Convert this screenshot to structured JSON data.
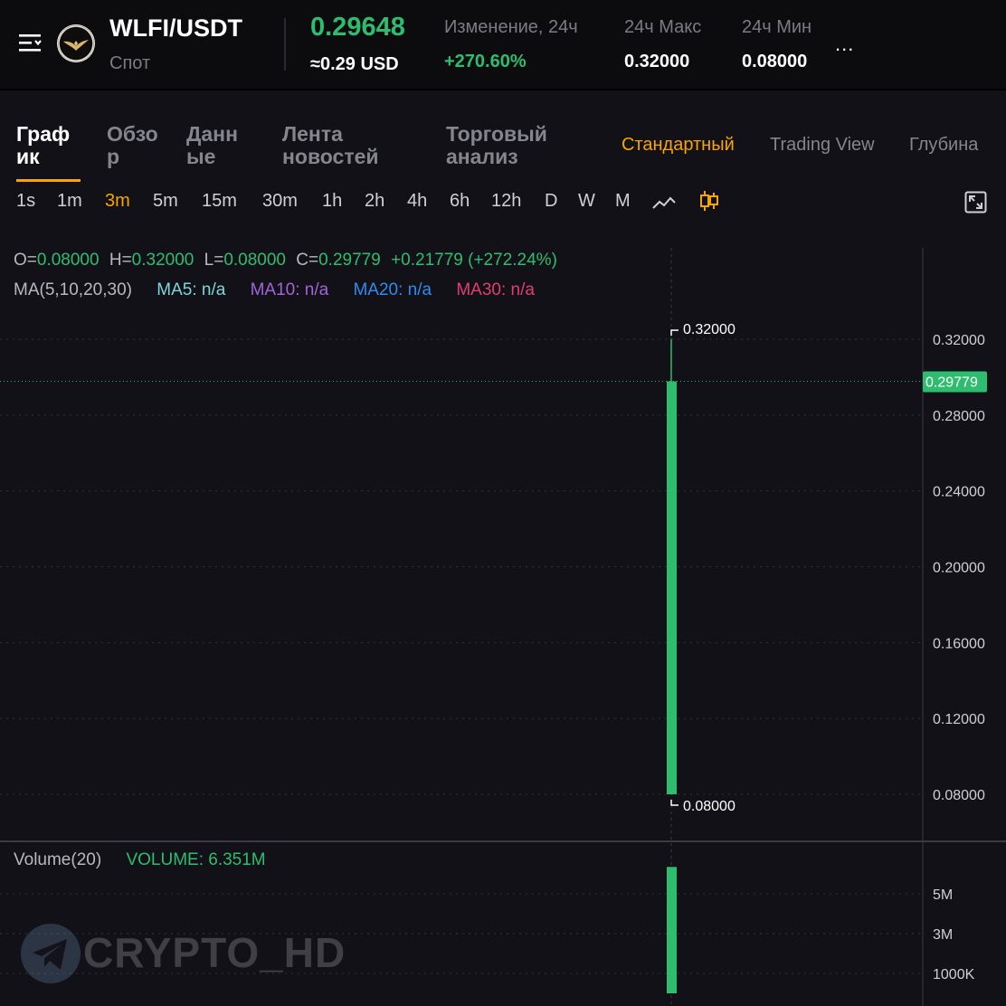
{
  "header": {
    "pair": "WLFI/USDT",
    "market": "Спот",
    "price": "0.29648",
    "price_usd": "≈0.29 USD",
    "change_label": "Изменение, 24ч",
    "change_value": "+270.60%",
    "high_label": "24ч Макс",
    "high_value": "0.32000",
    "low_label": "24ч Мин",
    "low_value": "0.08000",
    "more": "..."
  },
  "tabs": {
    "chart": [
      "Граф",
      "ик"
    ],
    "overview": [
      "Обзо",
      "р"
    ],
    "data": [
      "Данн",
      "ые"
    ],
    "news": [
      "Лента",
      "новостей"
    ],
    "analysis": [
      "Торговый",
      "анализ"
    ]
  },
  "views": {
    "standard": "Стандартный",
    "tradingview": "Trading View",
    "depth": "Глубина"
  },
  "intervals": [
    "1s",
    "1m",
    "3m",
    "5m",
    "15m",
    "30m",
    "1h",
    "2h",
    "4h",
    "6h",
    "12h",
    "D",
    "W",
    "M"
  ],
  "active_interval": "3m",
  "ohlc": {
    "o_label": "O=",
    "o": "0.08000",
    "h_label": "H=",
    "h": "0.32000",
    "l_label": "L=",
    "l": "0.08000",
    "c_label": "C=",
    "c": "0.29779",
    "change": "+0.21779 (+272.24%)"
  },
  "ma": {
    "label": "MA(5,10,20,30)",
    "ma5": "MA5: n/a",
    "ma10": "MA10: n/a",
    "ma20": "MA20: n/a",
    "ma30": "MA30: n/a"
  },
  "volume": {
    "label": "Volume(20)",
    "value": "VOLUME: 6.351M"
  },
  "watermark": "CRYPTO_HD",
  "colors": {
    "up": "#2ebd6e",
    "accent": "#f7a600",
    "ma5": "#7ed6d8",
    "ma10": "#a364d8",
    "ma20": "#2f8bf0",
    "ma30": "#e23d71",
    "background": "#121118"
  },
  "chart_data": {
    "type": "candlestick",
    "price_ticks": [
      "0.32000",
      "0.28000",
      "0.24000",
      "0.20000",
      "0.16000",
      "0.12000",
      "0.08000"
    ],
    "price_range": [
      0.08,
      0.32
    ],
    "candles": [
      {
        "open": 0.08,
        "high": 0.32,
        "low": 0.08,
        "close": 0.29779
      }
    ],
    "last_price_label": "0.29779",
    "high_marker": "0.32000",
    "low_marker": "0.08000",
    "volume_ticks": [
      "5M",
      "3M",
      "1000K"
    ],
    "volume_values": [
      6.351
    ],
    "volume_unit": "M"
  }
}
